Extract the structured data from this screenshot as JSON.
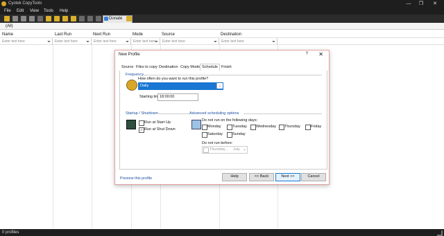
{
  "window": {
    "title": "Cyotek CopyTools",
    "min": "—",
    "max": "❐",
    "close": "✕"
  },
  "menu": [
    "File",
    "Edit",
    "View",
    "Tools",
    "Help"
  ],
  "toolbar": {
    "donate": "Donate"
  },
  "filter": {
    "label": "(All)"
  },
  "columns": [
    "Name",
    "Last Run",
    "Next Run",
    "Mode",
    "Source",
    "Destination"
  ],
  "filter_placeholder": "Enter text here",
  "status": {
    "text": "0 profiles"
  },
  "dialog": {
    "title": "New Profile",
    "help_glyph": "?",
    "close_glyph": "✕",
    "tabs": [
      "Source",
      "Files to copy",
      "Destination",
      "Copy Mode",
      "Schedule",
      "Finish"
    ],
    "active_tab": "Schedule",
    "frequency": {
      "group": "Frequency",
      "question": "How often do you want to run this profile?",
      "value": "Daily",
      "starting_label": "Starting time:",
      "starting_value": "18:00:00"
    },
    "startup": {
      "group": "Startup / Shutdown",
      "run_startup": "Run at Start Up",
      "run_shutdown": "Run at Shut Down",
      "run_startup_checked": false,
      "run_shutdown_checked": true
    },
    "advanced": {
      "group": "Advanced scheduling options",
      "days_label": "Do not run on the following days:",
      "days": [
        "Monday",
        "Tuesday",
        "Wednesday",
        "Thursday",
        "Friday",
        "Saturday",
        "Sunday"
      ],
      "before_label": "Do not run before:",
      "before_value": "Thursday ,",
      "before_month": "July"
    },
    "preview_link": "Preview this profile",
    "buttons": {
      "help": "Help",
      "back": "<< Back",
      "next": "Next >>",
      "cancel": "Cancel"
    }
  },
  "colors": {
    "accent": "#1976d2",
    "chrome": "#1e1e1e"
  }
}
